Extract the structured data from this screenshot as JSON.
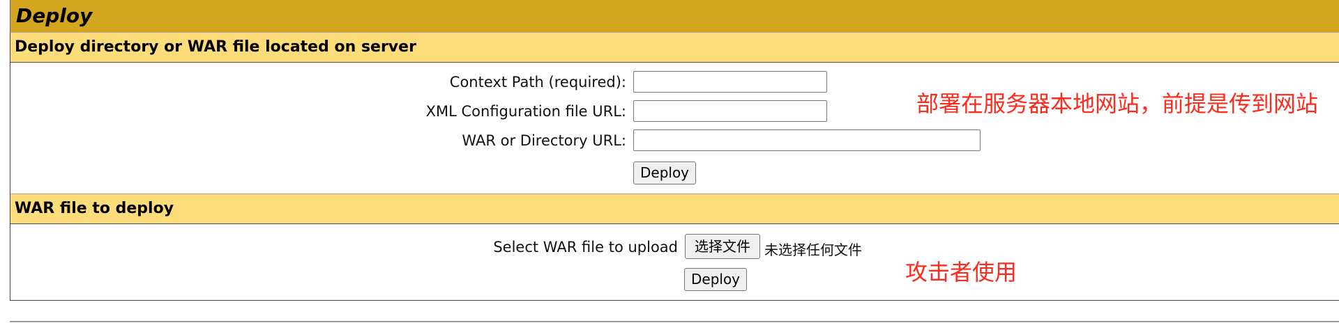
{
  "deploy_section": {
    "title": "Deploy"
  },
  "server_deploy": {
    "header": "Deploy directory or WAR file located on server",
    "context_path_label": "Context Path (required):",
    "context_path_value": "",
    "xml_config_label": "XML Configuration file URL:",
    "xml_config_value": "",
    "war_dir_label": "WAR or Directory URL:",
    "war_dir_value": "",
    "deploy_button": "Deploy"
  },
  "war_upload": {
    "header": "WAR file to deploy",
    "select_label": "Select WAR file to upload",
    "choose_file_button": "选择文件",
    "no_file_text": "未选择任何文件",
    "deploy_button": "Deploy"
  },
  "annotations": {
    "server_note": "部署在服务器本地网站，前提是传到网站",
    "attacker_note": "攻击者使用",
    "color": "#ff2a1a"
  },
  "colors": {
    "title_bar": "#d4a51f",
    "section_header": "#ffdc7a"
  }
}
